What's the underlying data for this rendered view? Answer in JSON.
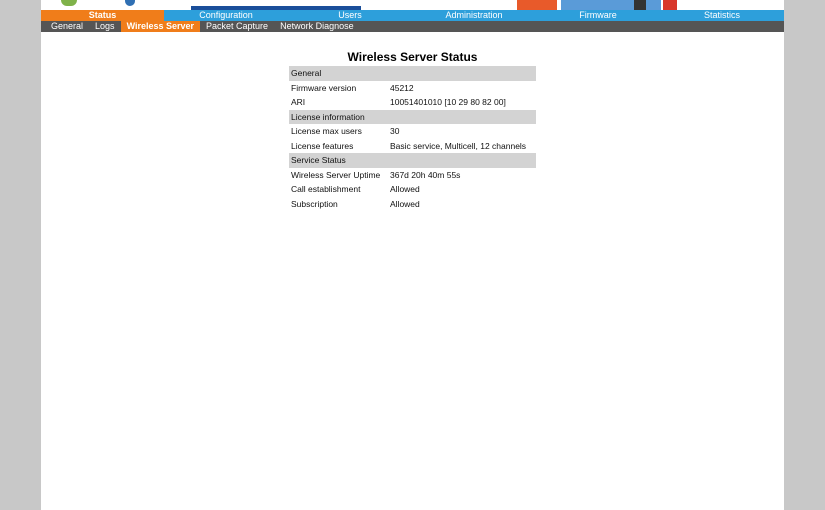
{
  "main_nav": {
    "items": [
      "Status",
      "Configuration",
      "Users",
      "Administration",
      "Firmware",
      "Statistics"
    ]
  },
  "sub_nav": {
    "items": [
      "General",
      "Logs",
      "Wireless Server",
      "Packet Capture",
      "Network Diagnose"
    ]
  },
  "page": {
    "title": "Wireless Server Status"
  },
  "sections": {
    "general": {
      "heading": "General",
      "firmware_label": "Firmware version",
      "firmware_value": "45212",
      "ari_label": "ARI",
      "ari_value": "10051401010 [10 29 80 82 00]"
    },
    "license": {
      "heading": "License information",
      "max_users_label": "License max users",
      "max_users_value": "30",
      "features_label": "License features",
      "features_value": "Basic service, Multicell, 12 channels"
    },
    "service": {
      "heading": "Service Status",
      "uptime_label": "Wireless Server Uptime",
      "uptime_value": "367d 20h 40m 55s",
      "call_label": "Call establishment",
      "call_value": "Allowed",
      "subscription_label": "Subscription",
      "subscription_value": "Allowed"
    }
  },
  "colors": {
    "nav_blue": "#2d9fdb",
    "nav_active_orange": "#f07d1a",
    "subnav_gray": "#555555",
    "section_gray": "#d3d3d3"
  }
}
